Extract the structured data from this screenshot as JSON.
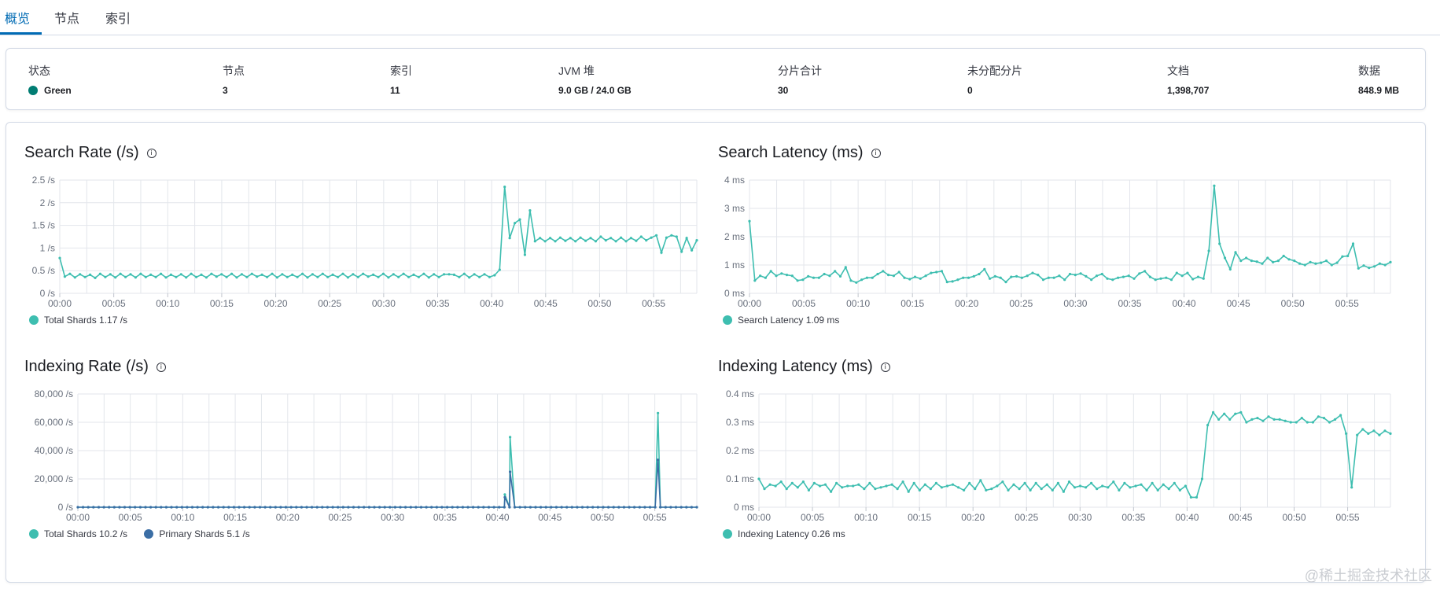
{
  "tabs": [
    {
      "label": "概览",
      "active": true
    },
    {
      "label": "节点",
      "active": false
    },
    {
      "label": "索引",
      "active": false
    }
  ],
  "summary": {
    "status": {
      "label": "状态",
      "value": "Green",
      "color": "#017d73"
    },
    "nodes": {
      "label": "节点",
      "value": "3"
    },
    "indices": {
      "label": "索引",
      "value": "11"
    },
    "jvm": {
      "label": "JVM 堆",
      "value": "9.0 GB / 24.0 GB"
    },
    "shards": {
      "label": "分片合计",
      "value": "30"
    },
    "unassigned": {
      "label": "未分配分片",
      "value": "0"
    },
    "docs": {
      "label": "文档",
      "value": "1,398,707"
    },
    "data": {
      "label": "数据",
      "value": "848.9 MB"
    }
  },
  "colors": {
    "teal": "#3ebeb0",
    "blue": "#3b6ea5"
  },
  "info_icon": "info-circle-icon",
  "chart_data": [
    {
      "type": "line",
      "title": "Search Rate (/s)",
      "x_ticks": [
        "00:00",
        "00:05",
        "00:10",
        "00:15",
        "00:20",
        "00:25",
        "00:30",
        "00:35",
        "00:40",
        "00:45",
        "00:50",
        "00:55"
      ],
      "y_ticks": [
        "0 /s",
        "0.5 /s",
        "1 /s",
        "1.5 /s",
        "2 /s",
        "2.5 /s"
      ],
      "y_tick_values": [
        0,
        0.5,
        1,
        1.5,
        2,
        2.5
      ],
      "ylim": [
        0,
        2.5
      ],
      "series": [
        {
          "name": "Total Shards",
          "legend": "Total Shards 1.17 /s",
          "color": "#3ebeb0",
          "values": [
            0.78,
            0.37,
            0.43,
            0.35,
            0.42,
            0.36,
            0.41,
            0.34,
            0.43,
            0.36,
            0.42,
            0.35,
            0.43,
            0.36,
            0.42,
            0.35,
            0.43,
            0.36,
            0.41,
            0.36,
            0.43,
            0.35,
            0.41,
            0.36,
            0.42,
            0.35,
            0.43,
            0.36,
            0.41,
            0.35,
            0.43,
            0.37,
            0.42,
            0.36,
            0.43,
            0.35,
            0.42,
            0.36,
            0.43,
            0.37,
            0.41,
            0.36,
            0.43,
            0.35,
            0.42,
            0.36,
            0.41,
            0.36,
            0.43,
            0.35,
            0.42,
            0.36,
            0.43,
            0.36,
            0.41,
            0.36,
            0.43,
            0.35,
            0.42,
            0.36,
            0.43,
            0.37,
            0.41,
            0.36,
            0.43,
            0.35,
            0.42,
            0.36,
            0.43,
            0.36,
            0.41,
            0.36,
            0.43,
            0.35,
            0.42,
            0.36,
            0.42,
            0.42,
            0.41,
            0.36,
            0.43,
            0.35,
            0.42,
            0.36,
            0.42,
            0.36,
            0.4,
            0.52,
            2.35,
            1.22,
            1.55,
            1.63,
            0.85,
            1.83,
            1.15,
            1.22,
            1.15,
            1.22,
            1.15,
            1.23,
            1.16,
            1.22,
            1.15,
            1.23,
            1.16,
            1.22,
            1.15,
            1.25,
            1.17,
            1.22,
            1.15,
            1.23,
            1.15,
            1.22,
            1.16,
            1.25,
            1.17,
            1.23,
            1.28,
            0.9,
            1.23,
            1.28,
            1.25,
            0.92,
            1.22,
            0.95,
            1.17
          ]
        }
      ]
    },
    {
      "type": "line",
      "title": "Search Latency (ms)",
      "x_ticks": [
        "00:00",
        "00:05",
        "00:10",
        "00:15",
        "00:20",
        "00:25",
        "00:30",
        "00:35",
        "00:40",
        "00:45",
        "00:50",
        "00:55"
      ],
      "y_ticks": [
        "0 ms",
        "1 ms",
        "2 ms",
        "3 ms",
        "4 ms"
      ],
      "y_tick_values": [
        0,
        1,
        2,
        3,
        4
      ],
      "ylim": [
        0,
        4
      ],
      "series": [
        {
          "name": "Search Latency",
          "legend": "Search Latency 1.09 ms",
          "color": "#3ebeb0",
          "values": [
            2.55,
            0.45,
            0.62,
            0.55,
            0.78,
            0.62,
            0.7,
            0.65,
            0.62,
            0.45,
            0.48,
            0.6,
            0.55,
            0.55,
            0.68,
            0.62,
            0.78,
            0.6,
            0.92,
            0.45,
            0.38,
            0.48,
            0.55,
            0.55,
            0.68,
            0.78,
            0.65,
            0.62,
            0.75,
            0.55,
            0.5,
            0.58,
            0.52,
            0.62,
            0.72,
            0.75,
            0.78,
            0.4,
            0.42,
            0.48,
            0.55,
            0.55,
            0.6,
            0.68,
            0.85,
            0.52,
            0.6,
            0.55,
            0.4,
            0.58,
            0.6,
            0.55,
            0.62,
            0.72,
            0.65,
            0.48,
            0.55,
            0.55,
            0.62,
            0.48,
            0.68,
            0.65,
            0.7,
            0.6,
            0.48,
            0.62,
            0.68,
            0.52,
            0.48,
            0.55,
            0.58,
            0.62,
            0.52,
            0.7,
            0.78,
            0.58,
            0.48,
            0.52,
            0.55,
            0.48,
            0.72,
            0.62,
            0.72,
            0.5,
            0.58,
            0.52,
            1.5,
            3.8,
            1.75,
            1.25,
            0.85,
            1.45,
            1.15,
            1.25,
            1.15,
            1.12,
            1.05,
            1.25,
            1.1,
            1.15,
            1.32,
            1.2,
            1.15,
            1.05,
            1.0,
            1.1,
            1.05,
            1.08,
            1.15,
            1.0,
            1.08,
            1.3,
            1.32,
            1.75,
            0.88,
            0.98,
            0.9,
            0.95,
            1.05,
            1.0,
            1.1
          ]
        }
      ]
    },
    {
      "type": "line",
      "title": "Indexing Rate (/s)",
      "x_ticks": [
        "00:00",
        "00:05",
        "00:10",
        "00:15",
        "00:20",
        "00:25",
        "00:30",
        "00:35",
        "00:40",
        "00:45",
        "00:50",
        "00:55"
      ],
      "y_ticks": [
        "0 /s",
        "20,000 /s",
        "40,000 /s",
        "60,000 /s",
        "80,000 /s"
      ],
      "y_tick_values": [
        0,
        20000,
        40000,
        60000,
        80000
      ],
      "ylim": [
        0,
        80000
      ],
      "series": [
        {
          "name": "Total Shards",
          "legend": "Total Shards 10.2 /s",
          "color": "#3ebeb0",
          "spikes": [
            {
              "x_minute": 40.7,
              "value": 9000
            },
            {
              "x_minute": 41.2,
              "value": 49500
            },
            {
              "x_minute": 55.3,
              "value": 66500
            }
          ],
          "baseline": 0
        },
        {
          "name": "Primary Shards",
          "legend": "Primary Shards 5.1 /s",
          "color": "#3b6ea5",
          "spikes": [
            {
              "x_minute": 40.7,
              "value": 7000
            },
            {
              "x_minute": 41.2,
              "value": 25000
            },
            {
              "x_minute": 55.3,
              "value": 33500
            }
          ],
          "baseline": 0
        }
      ]
    },
    {
      "type": "line",
      "title": "Indexing Latency (ms)",
      "x_ticks": [
        "00:00",
        "00:05",
        "00:10",
        "00:15",
        "00:20",
        "00:25",
        "00:30",
        "00:35",
        "00:40",
        "00:45",
        "00:50",
        "00:55"
      ],
      "y_ticks": [
        "0 ms",
        "0.1 ms",
        "0.2 ms",
        "0.3 ms",
        "0.4 ms"
      ],
      "y_tick_values": [
        0,
        0.1,
        0.2,
        0.3,
        0.4
      ],
      "ylim": [
        0,
        0.4
      ],
      "series": [
        {
          "name": "Indexing Latency",
          "legend": "Indexing Latency 0.26 ms",
          "color": "#3ebeb0",
          "values": [
            0.1,
            0.065,
            0.08,
            0.075,
            0.09,
            0.065,
            0.085,
            0.07,
            0.09,
            0.06,
            0.085,
            0.075,
            0.08,
            0.055,
            0.085,
            0.07,
            0.075,
            0.075,
            0.08,
            0.065,
            0.085,
            0.065,
            0.07,
            0.075,
            0.08,
            0.065,
            0.09,
            0.055,
            0.085,
            0.06,
            0.08,
            0.065,
            0.085,
            0.07,
            0.075,
            0.08,
            0.07,
            0.06,
            0.085,
            0.065,
            0.095,
            0.06,
            0.065,
            0.075,
            0.09,
            0.06,
            0.08,
            0.065,
            0.085,
            0.06,
            0.085,
            0.065,
            0.08,
            0.06,
            0.085,
            0.055,
            0.09,
            0.07,
            0.075,
            0.07,
            0.085,
            0.065,
            0.075,
            0.07,
            0.09,
            0.06,
            0.085,
            0.07,
            0.075,
            0.08,
            0.06,
            0.085,
            0.06,
            0.08,
            0.065,
            0.085,
            0.06,
            0.075,
            0.035,
            0.035,
            0.1,
            0.29,
            0.335,
            0.31,
            0.33,
            0.31,
            0.33,
            0.335,
            0.3,
            0.31,
            0.315,
            0.305,
            0.32,
            0.31,
            0.31,
            0.305,
            0.3,
            0.3,
            0.315,
            0.3,
            0.3,
            0.32,
            0.315,
            0.3,
            0.31,
            0.325,
            0.26,
            0.07,
            0.255,
            0.275,
            0.26,
            0.27,
            0.255,
            0.27,
            0.26
          ]
        }
      ]
    }
  ],
  "watermark": "@稀土掘金技术社区"
}
